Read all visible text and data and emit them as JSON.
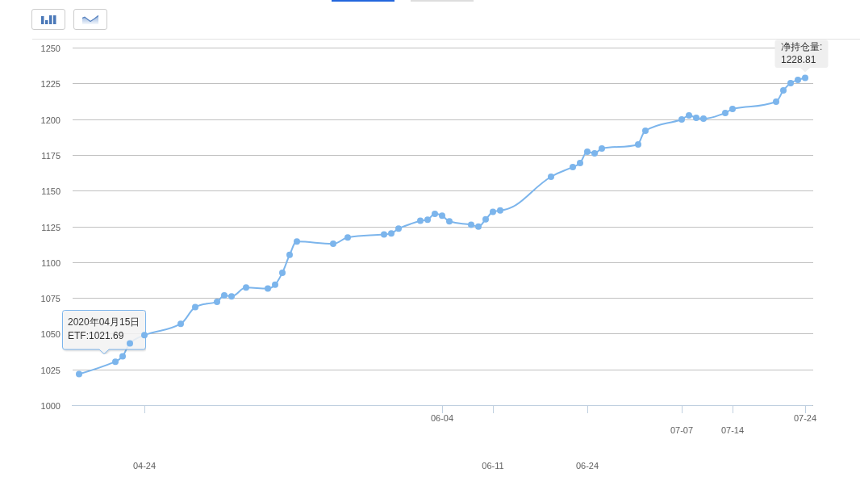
{
  "tabs": [
    {
      "selected": true
    },
    {
      "selected": false
    }
  ],
  "chart_buttons": [
    {
      "kind": "bar"
    },
    {
      "kind": "line"
    }
  ],
  "chart": {
    "chart_data": {
      "type": "line",
      "grid": true,
      "marker": true,
      "categories": [
        null,
        null,
        null,
        null,
        null,
        null,
        null,
        null,
        null,
        "04-24",
        null,
        null,
        null,
        null,
        null,
        null,
        null,
        null,
        null,
        null,
        null,
        null,
        null,
        null,
        null,
        null,
        null,
        null,
        null,
        null,
        null,
        null,
        null,
        null,
        null,
        null,
        null,
        null,
        null,
        null,
        null,
        null,
        null,
        null,
        null,
        null,
        null,
        null,
        null,
        null,
        "06-04",
        null,
        null,
        null,
        null,
        null,
        null,
        "06-11",
        null,
        null,
        null,
        null,
        null,
        null,
        null,
        null,
        null,
        null,
        null,
        null,
        "06-24",
        null,
        null,
        null,
        null,
        null,
        null,
        null,
        null,
        null,
        null,
        null,
        null,
        "07-07",
        null,
        null,
        null,
        null,
        null,
        null,
        "07-14",
        null,
        null,
        null,
        null,
        null,
        null,
        null,
        null,
        null,
        "07-24"
      ],
      "values": [
        1021.7,
        null,
        null,
        null,
        null,
        1030.4,
        1034.2,
        1043.2,
        null,
        1048.9,
        null,
        null,
        null,
        null,
        1056.9,
        null,
        1068.5,
        null,
        null,
        1072.3,
        1076.7,
        1076.1,
        null,
        1082.2,
        null,
        null,
        1081.5,
        1084.2,
        1092.6,
        1105.1,
        1114.4,
        null,
        null,
        null,
        null,
        1112.8,
        null,
        1117.2,
        null,
        null,
        null,
        null,
        1119.4,
        1120,
        1123.5,
        null,
        null,
        1128.9,
        1129.7,
        1133.7,
        1132.5,
        1128.5,
        null,
        null,
        1126.1,
        1124.9,
        1129.9,
        1135.2,
        1136.2,
        null,
        null,
        null,
        null,
        null,
        null,
        1159.7,
        null,
        null,
        1166.5,
        1169.3,
        1177.2,
        1176.1,
        1179.5,
        null,
        null,
        null,
        null,
        1182.3,
        1191.9,
        null,
        null,
        null,
        null,
        1199.8,
        1202.6,
        1200.9,
        1200.3,
        null,
        null,
        1204.3,
        1207.1,
        null,
        null,
        null,
        null,
        null,
        1212.2,
        1220.1,
        1225.2,
        1227.4,
        1228.8
      ],
      "ylim": [
        1000,
        1250
      ],
      "yticks": [
        1000,
        1025,
        1050,
        1075,
        1100,
        1125,
        1150,
        1175,
        1200,
        1225,
        1250
      ],
      "annotations": [
        "2020年04月15日\nETF:1021.69",
        {
          "x": "07-24",
          "y": 1228.8,
          "text": "净持仓量:\n1228.81"
        }
      ]
    }
  }
}
